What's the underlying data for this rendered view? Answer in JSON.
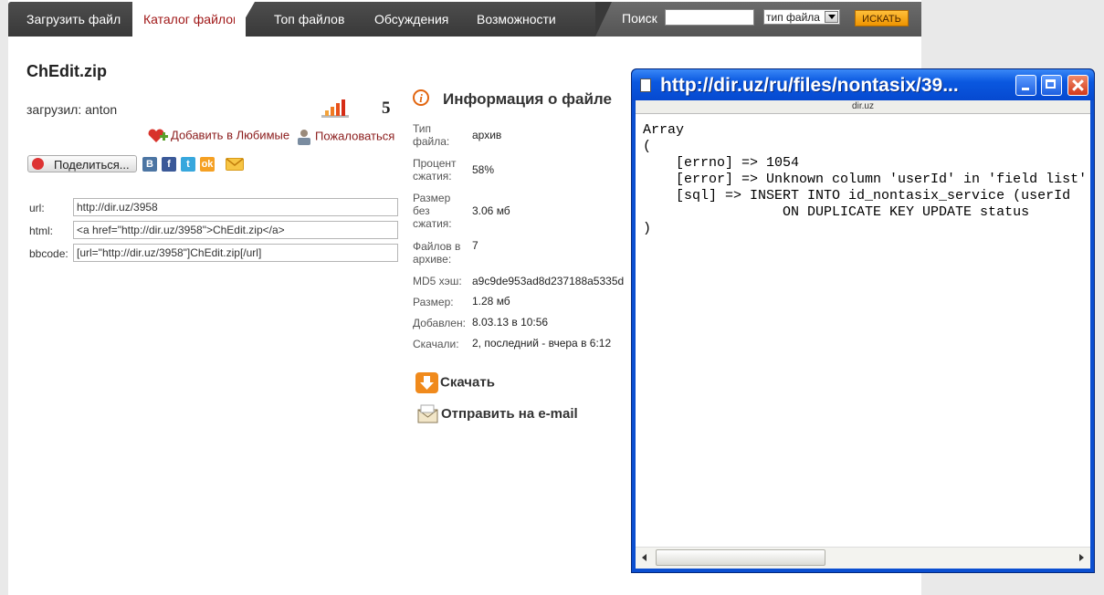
{
  "nav": {
    "items": [
      {
        "label": "Загрузить файл"
      },
      {
        "label": "Каталог файлов"
      },
      {
        "label": "Топ файлов"
      },
      {
        "label": "Обсуждения"
      },
      {
        "label": "Возможности"
      }
    ],
    "search_label": "Поиск",
    "search_value": "",
    "filetype_value": "тип файла",
    "search_button": "ИСКАТЬ"
  },
  "file": {
    "title": "ChEdit.zip",
    "uploader": "загрузил: anton",
    "rating": "5",
    "favorites": "Добавить в Любимые",
    "report": "Пожаловаться",
    "share": "Поделиться...",
    "social_icons": [
      "vk-icon",
      "facebook-icon",
      "twitter-icon",
      "odnoklassniki-icon",
      "mail-icon"
    ],
    "links": [
      {
        "label": "url:",
        "value": "http://dir.uz/3958"
      },
      {
        "label": "html:",
        "value": "<a href=\"http://dir.uz/3958\">ChEdit.zip</a>"
      },
      {
        "label": "bbcode:",
        "value": "[url=\"http://dir.uz/3958\"]ChEdit.zip[/url]"
      }
    ]
  },
  "info": {
    "title": "Информация о файле",
    "rows": [
      {
        "label": "Тип файла:",
        "value": "архив"
      },
      {
        "label": "Процент сжатия:",
        "value": "58%"
      },
      {
        "label": "Размер без сжатия:",
        "value": "3.06 мб"
      },
      {
        "label": "Файлов в архиве:",
        "value": "7"
      },
      {
        "label": "MD5 хэш:",
        "value": "a9c9de953ad8d237188a5335d"
      },
      {
        "label": "Размер:",
        "value": "1.28 мб"
      },
      {
        "label": "Добавлен:",
        "value": "8.03.13 в 10:56"
      },
      {
        "label": "Скачали:",
        "value": "2, последний - вчера в 6:12"
      }
    ],
    "download": "Скачать",
    "send_email": "Отправить на e-mail"
  },
  "popup": {
    "title": "http://dir.uz/ru/files/nontasix/39...",
    "address": "dir.uz",
    "content": "Array\n(\n    [errno] => 1054\n    [error] => Unknown column 'userId' in 'field list'\n    [sql] => INSERT INTO id_nontasix_service (userId\n                 ON DUPLICATE KEY UPDATE status\n)"
  },
  "colors": {
    "nav_bg": "#3f3f3f",
    "nav_active_text": "#a01818",
    "link": "#8a1a1a",
    "accent_orange": "#ee9400",
    "window_blue": "#0a58e0"
  }
}
